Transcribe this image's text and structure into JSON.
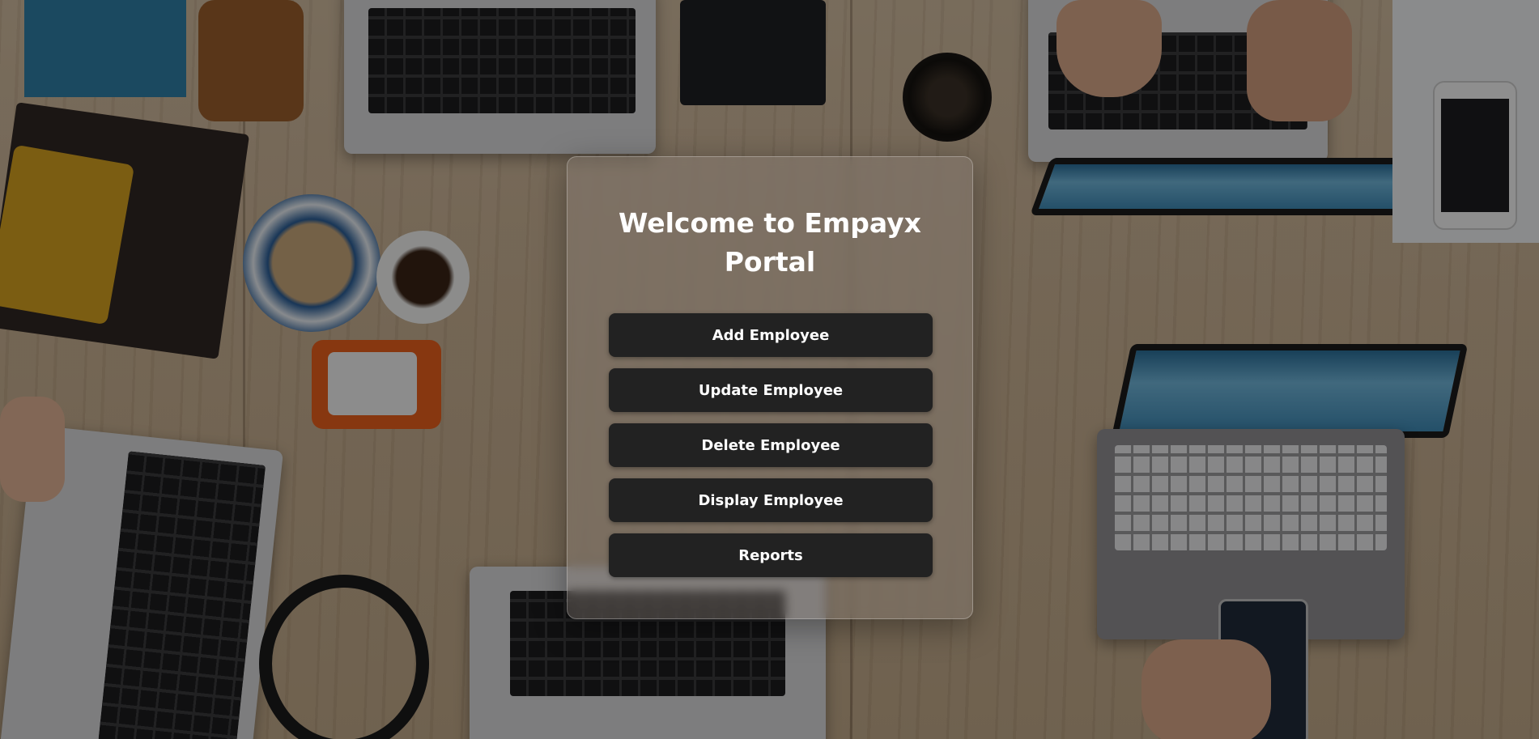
{
  "page": {
    "title_line1": "Welcome to Empayx",
    "title_line2": "Portal"
  },
  "menu": {
    "buttons": [
      {
        "label": "Add Employee"
      },
      {
        "label": "Update Employee"
      },
      {
        "label": "Delete Employee"
      },
      {
        "label": "Display Employee"
      },
      {
        "label": "Reports"
      }
    ]
  },
  "colors": {
    "button_bg": "#222222",
    "button_text": "#ffffff",
    "title_text": "#ffffff",
    "overlay": "rgba(0,0,0,0.42)"
  }
}
